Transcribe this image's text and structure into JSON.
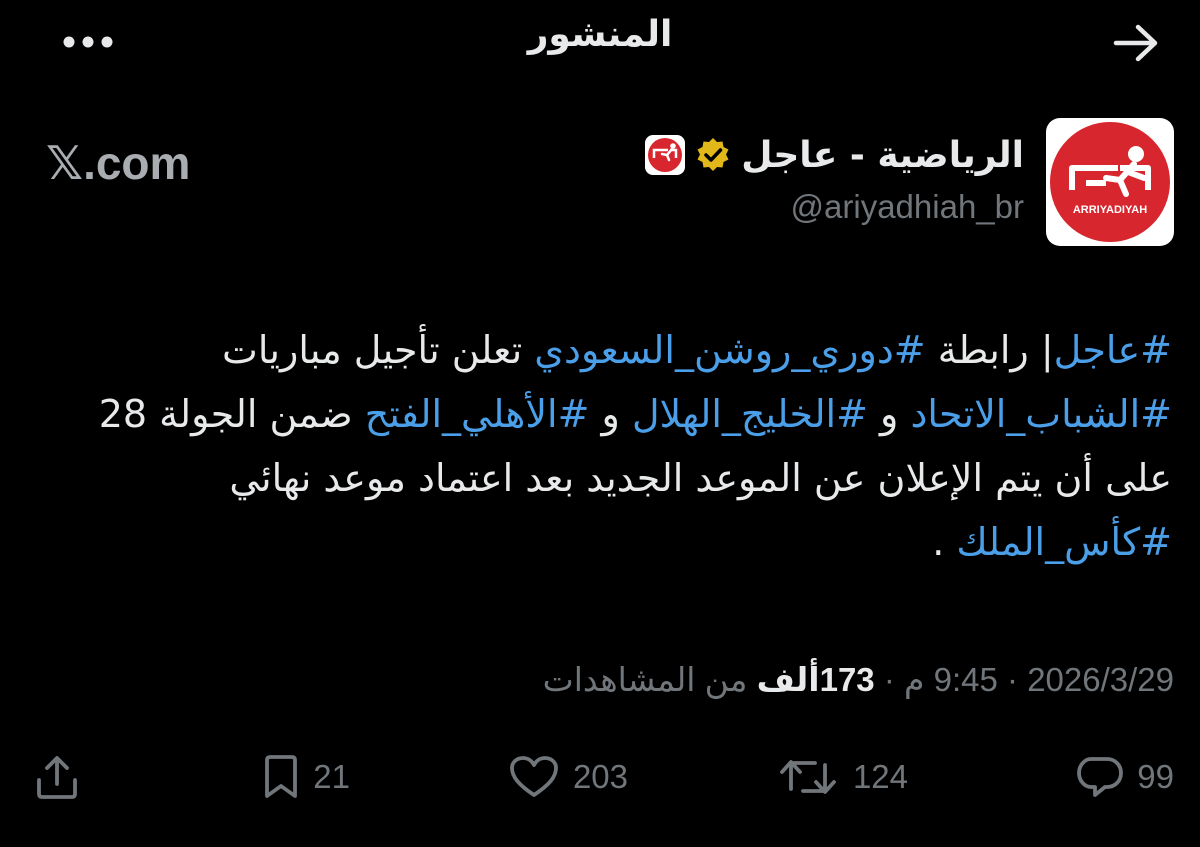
{
  "header": {
    "title": "المنشور",
    "back_icon": "arrow-right-icon",
    "more_icon": "more-horizontal-icon"
  },
  "author": {
    "display_name": "الرياضية - عاجل",
    "handle": "@ariyadhiah_br",
    "avatar_text": "ARRIYADIYAH",
    "verified": true
  },
  "watermark": {
    "x_glyph": "𝕏",
    "domain": ".com"
  },
  "tweet": {
    "tokens": [
      {
        "t": "#عاجل",
        "tag": true
      },
      {
        "t": "| رابطة ",
        "tag": false
      },
      {
        "t": "#دوري_روشن_السعودي",
        "tag": true
      },
      {
        "t": " تعلن تأجيل مباريات ",
        "tag": false
      },
      {
        "t": "#الشباب_الاتحاد",
        "tag": true
      },
      {
        "t": " و ",
        "tag": false
      },
      {
        "t": "#الخليج_الهلال",
        "tag": true
      },
      {
        "t": " و ",
        "tag": false
      },
      {
        "t": "#الأهلي_الفتح",
        "tag": true
      },
      {
        "t": " ضمن الجولة 28 على أن يتم الإعلان عن الموعد الجديد بعد اعتماد موعد نهائي ",
        "tag": false
      },
      {
        "t": "#كأس_الملك",
        "tag": true
      },
      {
        "t": " .",
        "tag": false
      }
    ]
  },
  "meta": {
    "date": "2026/3/29",
    "time": "9:45 م",
    "separator": "·",
    "views_count": "173",
    "views_unit": "ألف",
    "views_label": "من المشاهدات"
  },
  "actions": {
    "replies": "99",
    "reposts": "124",
    "likes": "203",
    "bookmarks": "21"
  },
  "colors": {
    "background": "#000000",
    "text": "#e7e9ea",
    "secondary": "#71767b",
    "hashtag": "#4a9fe8",
    "brand_red": "#d8262e",
    "verified_gold": "#e2b719"
  }
}
